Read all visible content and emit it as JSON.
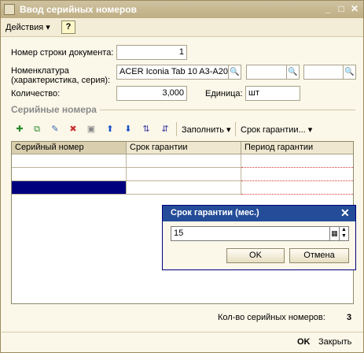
{
  "window": {
    "title": "Ввод серийных номеров",
    "min": "_",
    "max": "□",
    "close": "✕"
  },
  "menu": {
    "actions": "Действия ▾",
    "help": "?"
  },
  "form": {
    "row_number_label": "Номер строки документа:",
    "row_number": "1",
    "nomenclature_label_1": "Номенклатура",
    "nomenclature_label_2": "(характеристика, серия):",
    "nomenclature": "ACER Iconia Tab 10 A3-A20",
    "quantity_label": "Количество:",
    "quantity": "3,000",
    "unit_label": "Единица:",
    "unit": "шт"
  },
  "section": {
    "title": "Серийные номера"
  },
  "toolbar": {
    "fill": "Заполнить ▾",
    "warranty": "Срок гарантии... ▾"
  },
  "table": {
    "columns": [
      "Серийный номер",
      "Срок гарантии",
      "Период гарантии"
    ],
    "rows": [
      [
        "",
        "",
        ""
      ],
      [
        "",
        "",
        ""
      ],
      [
        "",
        "",
        ""
      ]
    ]
  },
  "dialog": {
    "title": "Срок гарантии (мес.)",
    "value": "15",
    "ok": "OK",
    "cancel": "Отмена"
  },
  "footer": {
    "count_label": "Кол-во серийных номеров:",
    "count": "3",
    "ok": "OK",
    "close": "Закрыть"
  }
}
